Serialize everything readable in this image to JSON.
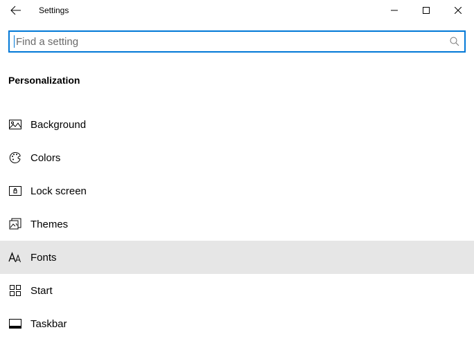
{
  "window": {
    "title": "Settings"
  },
  "search": {
    "placeholder": "Find a setting"
  },
  "category": {
    "title": "Personalization"
  },
  "nav": {
    "items": [
      {
        "label": "Background"
      },
      {
        "label": "Colors"
      },
      {
        "label": "Lock screen"
      },
      {
        "label": "Themes"
      },
      {
        "label": "Fonts"
      },
      {
        "label": "Start"
      },
      {
        "label": "Taskbar"
      }
    ],
    "selected_index": 4
  }
}
